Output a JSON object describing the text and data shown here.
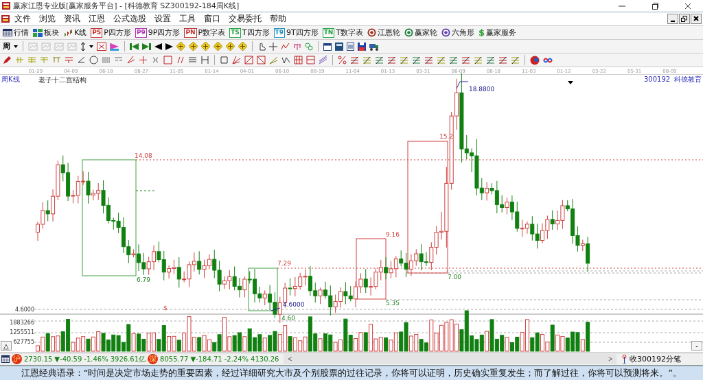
{
  "window": {
    "title": "赢家江恩专业版[赢家服务平台] - [科德教育 SZ300192-184周K线]"
  },
  "menu": [
    "文件",
    "浏览",
    "资讯",
    "江恩",
    "公式选股",
    "设置",
    "工具",
    "窗口",
    "交易委托",
    "帮助"
  ],
  "main_toolbar": [
    {
      "label": "行情"
    },
    {
      "label": "板块"
    },
    {
      "label": "K线"
    },
    {
      "label": "P四方形",
      "icon_text": "PS"
    },
    {
      "label": "9P四方形",
      "icon_text": "P9"
    },
    {
      "label": "P数字表",
      "icon_text": "PN"
    },
    {
      "label": "T四方形",
      "icon_text": "TS"
    },
    {
      "label": "9T四方形",
      "icon_text": "T9"
    },
    {
      "label": "T数字表",
      "icon_text": "TN"
    },
    {
      "label": "江恩轮"
    },
    {
      "label": "赢家轮"
    },
    {
      "label": "六角形"
    },
    {
      "label": "赢家服务",
      "icon_text": "$"
    }
  ],
  "period": {
    "label": "周"
  },
  "chart": {
    "period_label": "周K线",
    "study_title": "老子十二宫结构",
    "stock_code": "300192",
    "stock_name": "科德教育",
    "dates": [
      "01-29",
      "04-09",
      "06-18",
      "08-27",
      "11-05",
      "01-14",
      "04-01",
      "06-10",
      "08-19",
      "11-04",
      "01-13",
      "03-31",
      "06-09",
      "08-18",
      "11-03",
      "01-12",
      "03-22",
      "05-31",
      "08-09"
    ],
    "price_axis": [
      "4.6000"
    ],
    "volume_axis": [
      "1883266",
      "1255511",
      "627755"
    ],
    "annotations": [
      {
        "text": "14.08",
        "kind": "high"
      },
      {
        "text": "6.79",
        "kind": "low"
      },
      {
        "text": "18.8800",
        "kind": "pivot"
      },
      {
        "text": "15.2",
        "kind": "high"
      },
      {
        "text": "7.29",
        "kind": "high"
      },
      {
        "text": "7.00",
        "kind": "low"
      },
      {
        "text": "9.16",
        "kind": "high"
      },
      {
        "text": "5.35",
        "kind": "low"
      },
      {
        "text": "4.6000",
        "kind": "pivot"
      },
      {
        "text": "4.60",
        "kind": "low"
      },
      {
        "text": "$",
        "kind": "high"
      }
    ]
  },
  "status_bar": {
    "indices": [
      {
        "badge": "沪",
        "value": "2730.15",
        "change": "▼-40.59",
        "percent": "-1.46%",
        "amount": "3926.61亿"
      },
      {
        "badge": "深",
        "value": "8055.77",
        "change": "▼-184.71",
        "percent": "-2.24%",
        "amount": "4130.26"
      }
    ],
    "scroll_left": "<",
    "scroll_right": ">",
    "feed": "收300192分笔",
    "panel_up": "△",
    "panel_down": "-"
  },
  "quote": "江恩经典语录：“时间是决定市场走势的重要因素，经过详细研究大市及个别股票的过往记录，你将可以证明，历史确实重复发生；而了解过往，你将可以预测将来。”。"
}
